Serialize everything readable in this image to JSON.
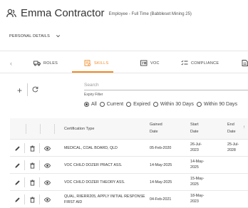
{
  "header": {
    "title": "Emma Contractor",
    "subtitle": "Employee - Full Time (Babbleset Mining 25)"
  },
  "personal_details": {
    "label": "PERSONAL DETAILS"
  },
  "tabs": [
    {
      "label": "ROLES",
      "icon": "truck-icon"
    },
    {
      "label": "SKILLS",
      "icon": "certificate-icon",
      "active": true
    },
    {
      "label": "VOC",
      "icon": "id-card-icon"
    },
    {
      "label": "COMPLIANCE",
      "icon": "checklist-icon"
    }
  ],
  "search": {
    "placeholder": "Search"
  },
  "expiry_filter": {
    "label": "Expiry Filter",
    "options": [
      "All",
      "Current",
      "Expired",
      "Within 30 Days",
      "Within 90 Days"
    ],
    "selected": "All"
  },
  "table": {
    "columns": [
      "Certification Type",
      "Gained Date",
      "Start Date",
      "End Date"
    ],
    "rows": [
      {
        "type": "MEDICAL, COAL BOARD, QLD",
        "gained": "05-Feb-2020",
        "start": "26-Jul-2023",
        "end": "25-Jul-2028"
      },
      {
        "type": "VOC CHILD DOZER PRACT ASS.",
        "gained": "14-May-2025",
        "start": "14-May-2025",
        "end": ""
      },
      {
        "type": "VOC CHILD DOZER THEORY ASS.",
        "gained": "14-May-2025",
        "start": "15-May-2025",
        "end": ""
      },
      {
        "type": "QUAL, RIIERR205, APPLY INITIAL RESPONSE FIRST AID",
        "gained": "04-Feb-2021",
        "start": "18-May-2023",
        "end": ""
      }
    ]
  },
  "colors": {
    "accent": "#f08a24",
    "text": "#333333"
  }
}
